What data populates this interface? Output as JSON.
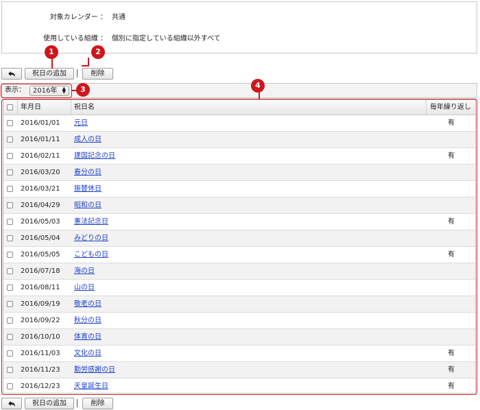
{
  "info": {
    "calendar_label": "対象カレンダー ：",
    "calendar_value": "共通",
    "org_label": "使用している組織 ：",
    "org_value": "個別に指定している組織以外すべて"
  },
  "toolbar": {
    "add_label": "祝日の追加",
    "delete_label": "削除"
  },
  "filter": {
    "label": "表示：",
    "selected_year": "2016年"
  },
  "table": {
    "headers": {
      "date": "年月日",
      "name": "祝日名",
      "repeat": "毎年繰り返し"
    },
    "rows": [
      {
        "date": "2016/01/01",
        "name": "元日",
        "repeat": "有"
      },
      {
        "date": "2016/01/11",
        "name": "成人の日",
        "repeat": ""
      },
      {
        "date": "2016/02/11",
        "name": "建国記念の日",
        "repeat": "有"
      },
      {
        "date": "2016/03/20",
        "name": "春分の日",
        "repeat": ""
      },
      {
        "date": "2016/03/21",
        "name": "振替休日",
        "repeat": ""
      },
      {
        "date": "2016/04/29",
        "name": "昭和の日",
        "repeat": ""
      },
      {
        "date": "2016/05/03",
        "name": "憲法記念日",
        "repeat": "有"
      },
      {
        "date": "2016/05/04",
        "name": "みどりの日",
        "repeat": ""
      },
      {
        "date": "2016/05/05",
        "name": "こどもの日",
        "repeat": "有"
      },
      {
        "date": "2016/07/18",
        "name": "海の日",
        "repeat": ""
      },
      {
        "date": "2016/08/11",
        "name": "山の日",
        "repeat": ""
      },
      {
        "date": "2016/09/19",
        "name": "敬老の日",
        "repeat": ""
      },
      {
        "date": "2016/09/22",
        "name": "秋分の日",
        "repeat": ""
      },
      {
        "date": "2016/10/10",
        "name": "体育の日",
        "repeat": ""
      },
      {
        "date": "2016/11/03",
        "name": "文化の日",
        "repeat": "有"
      },
      {
        "date": "2016/11/23",
        "name": "勤労感謝の日",
        "repeat": "有"
      },
      {
        "date": "2016/12/23",
        "name": "天皇誕生日",
        "repeat": "有"
      }
    ]
  },
  "callouts": [
    "1",
    "2",
    "3",
    "4"
  ],
  "colors": {
    "callout": "#d0151c",
    "link": "#1a3fc7"
  }
}
